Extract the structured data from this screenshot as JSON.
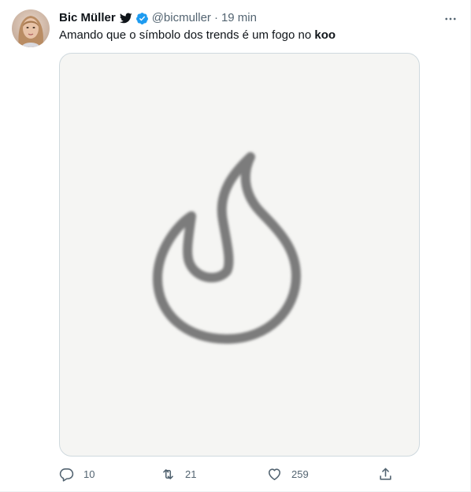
{
  "author": {
    "display_name": "Bic Müller",
    "handle": "@bicmuller",
    "separator": "·",
    "time": "19 min",
    "verified": true
  },
  "tweet": {
    "text_prefix": "Amando que o símbolo dos trends é um fogo no ",
    "text_bold": "koo"
  },
  "media": {
    "icon": "flame-icon",
    "background": "#f5f5f3"
  },
  "actions": {
    "replies": "10",
    "retweets": "21",
    "likes": "259"
  },
  "colors": {
    "text": "#0f1419",
    "secondary": "#536471",
    "verified": "#1d9bf0",
    "border": "#cfd9de"
  }
}
